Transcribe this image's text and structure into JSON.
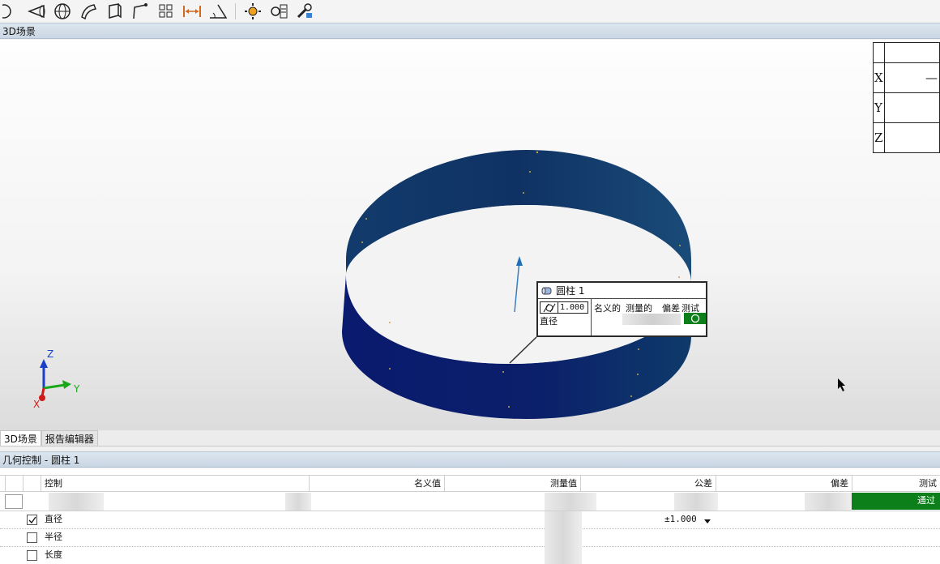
{
  "toolbar": {
    "icons": [
      "plane-icon",
      "cone-icon",
      "sphere-icon",
      "surface-icon",
      "box-icon",
      "line-icon",
      "grid-icon",
      "width-icon",
      "angle-icon",
      "settings-icon",
      "report-icon",
      "tool-icon"
    ]
  },
  "scene_panel": {
    "title": "3D场景"
  },
  "coord_table": {
    "rows": [
      {
        "label": "",
        "value": ""
      },
      {
        "label": "X",
        "value": "—"
      },
      {
        "label": "Y",
        "value": ""
      },
      {
        "label": "Z",
        "value": ""
      }
    ]
  },
  "triad": {
    "z": "Z",
    "y": "Y",
    "x": "X"
  },
  "callout": {
    "title": "圆柱 1",
    "tolerance": "1.000",
    "char_label": "直径",
    "col_nominal": "名义的",
    "col_measured": "测量的",
    "col_deviation": "偏差",
    "col_test": "测试"
  },
  "tabs": {
    "scene": "3D场景",
    "report": "报告编辑器"
  },
  "gc_panel": {
    "title": "几何控制 - 圆柱 1"
  },
  "grid": {
    "headers": {
      "control": "控制",
      "nominal": "名义值",
      "measured": "测量值",
      "tolerance": "公差",
      "deviation": "偏差",
      "test": "测试"
    },
    "summary_pass": "通过",
    "rows": [
      {
        "name": "直径",
        "checked": true,
        "tolerance": "±1.000"
      },
      {
        "name": "半径",
        "checked": false,
        "tolerance": ""
      },
      {
        "name": "长度",
        "checked": false,
        "tolerance": ""
      }
    ]
  },
  "colors": {
    "pass": "#0c7f1a",
    "cylinder": "#0b2a66",
    "panel_header": "#c9d6e3"
  }
}
